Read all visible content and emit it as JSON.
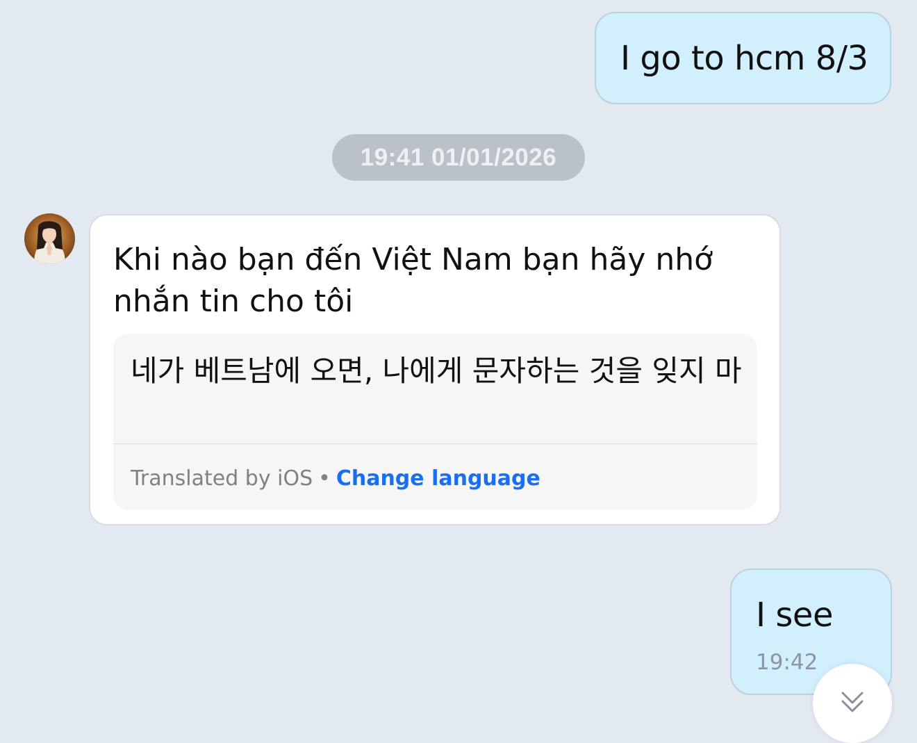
{
  "messages": {
    "outgoing_1": {
      "text": "I go to hcm 8/3"
    },
    "timestamp_divider": "19:41 01/01/2026",
    "incoming_1": {
      "original_text": "Khi nào bạn đến Việt Nam bạn hãy nhớ nhắn tin cho tôi",
      "translated_text": "네가 베트남에 오면, 나에게 문자하는 것을 잊지 마",
      "translated_by": "Translated by iOS",
      "separator": "•",
      "change_language_label": "Change language"
    },
    "outgoing_2": {
      "text": "I see",
      "time": "19:42"
    }
  },
  "icons": {
    "avatar": "contact-avatar",
    "scroll": "chevron-down-icon"
  },
  "colors": {
    "background": "#e2e9f1",
    "outgoing_bubble": "#d2effd",
    "incoming_bubble": "#ffffff",
    "link": "#1a6ff0"
  }
}
